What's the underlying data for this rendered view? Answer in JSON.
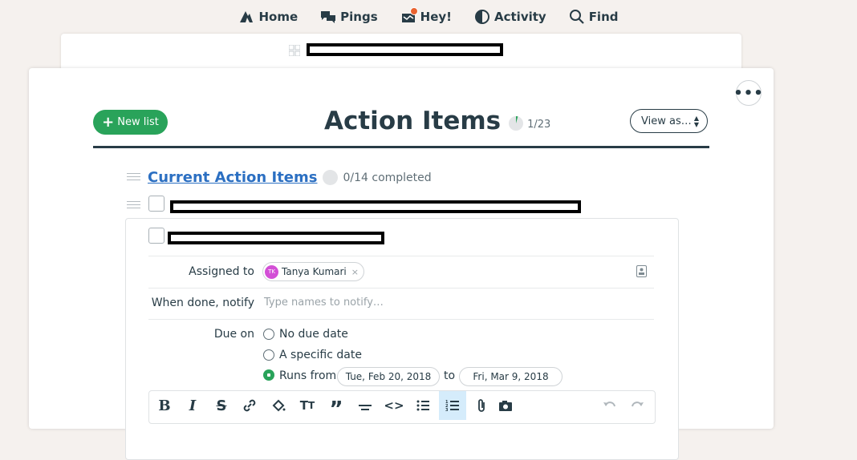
{
  "nav": {
    "home": "Home",
    "pings": "Pings",
    "hey": "Hey!",
    "activity": "Activity",
    "find": "Find"
  },
  "page": {
    "new_list_label": "New list",
    "title": "Action Items",
    "count": "1/23",
    "view_as": "View as…"
  },
  "list": {
    "title": "Current Action Items",
    "progress": "0/14 completed"
  },
  "todo": {
    "assigned_label": "Assigned to",
    "assignee_initials": "TK",
    "assignee_name": "Tanya Kumari",
    "assignee_remove": "×",
    "notify_label": "When done, notify",
    "notify_placeholder": "Type names to notify…",
    "due_label": "Due on",
    "due_options": [
      "No due date",
      "A specific date",
      "Runs from"
    ],
    "due_selected": "Runs from",
    "start_date": "Tue, Feb 20, 2018",
    "to_label": "to",
    "end_date": "Fri, Mar 9, 2018"
  },
  "colors": {
    "accent_green": "#29a35a",
    "link_blue": "#2b6fc2",
    "heading": "#283c46",
    "notification": "#e9622f",
    "avatar": "#d34fd6"
  },
  "icons": {
    "more": "•••",
    "plus": "+",
    "updown": "▲▼"
  }
}
